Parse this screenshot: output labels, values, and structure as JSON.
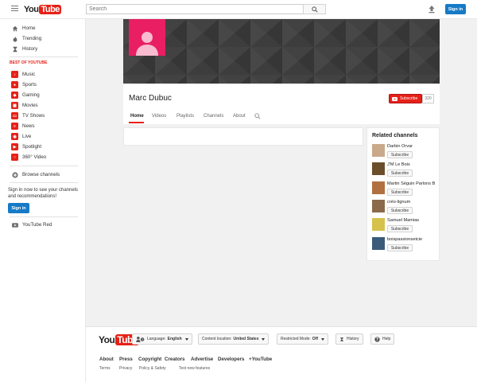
{
  "masthead": {
    "logo_you": "You",
    "logo_tube": "Tube",
    "search_placeholder": "Search",
    "signin_label": "Sign in"
  },
  "guide": {
    "primary": [
      {
        "label": "Home",
        "icon": "home-icon"
      },
      {
        "label": "Trending",
        "icon": "flame-icon"
      },
      {
        "label": "History",
        "icon": "hourglass-icon"
      }
    ],
    "best_of_heading": "BEST OF YOUTUBE",
    "best_of": [
      {
        "label": "Music",
        "icon": "music-icon"
      },
      {
        "label": "Sports",
        "icon": "sports-icon"
      },
      {
        "label": "Gaming",
        "icon": "gaming-icon"
      },
      {
        "label": "Movies",
        "icon": "movies-icon"
      },
      {
        "label": "TV Shows",
        "icon": "tv-icon"
      },
      {
        "label": "News",
        "icon": "news-icon"
      },
      {
        "label": "Live",
        "icon": "live-icon"
      },
      {
        "label": "Spotlight",
        "icon": "spotlight-icon"
      },
      {
        "label": "360° Video",
        "icon": "360-icon"
      }
    ],
    "browse_channels": "Browse channels",
    "signin_promo": "Sign in now to see your channels and recommendations!",
    "signin_label": "Sign in",
    "youtube_red": "YouTube Red"
  },
  "channel": {
    "title": "Marc Dubuc",
    "subscribe_label": "Subscribe",
    "subscriber_count": "320",
    "tabs": [
      "Home",
      "Videos",
      "Playlists",
      "Channels",
      "About"
    ],
    "active_tab": "Home"
  },
  "related": {
    "title": "Related channels",
    "subscribe_label": "Subscribe",
    "channels": [
      {
        "name": "Darbin Orvar",
        "thumb_color": "#c9a98a"
      },
      {
        "name": "J'M Le Bois",
        "thumb_color": "#6b4f2a"
      },
      {
        "name": "Martin Séguin Parlons Bois",
        "thumb_color": "#b07040"
      },
      {
        "name": "créo-lignum",
        "thumb_color": "#8a6a4a"
      },
      {
        "name": "Samuel Mamias",
        "thumb_color": "#d6c24a"
      },
      {
        "name": "boispassionsetcie",
        "thumb_color": "#3a5a7a"
      }
    ]
  },
  "footer": {
    "language_label": "Language:",
    "language_value": "English",
    "location_label": "Content location:",
    "location_value": "United States",
    "restricted_label": "Restricted Mode:",
    "restricted_value": "Off",
    "history_label": "History",
    "help_label": "Help",
    "links": [
      "About",
      "Press",
      "Copyright",
      "Creators",
      "Advertise",
      "Developers",
      "+YouTube"
    ],
    "small_links": [
      "Terms",
      "Privacy",
      "Policy & Safety",
      "Test new features"
    ]
  },
  "colors": {
    "brand_red": "#e62117",
    "signin_blue": "#167ac6",
    "avatar_pink": "#e91e63"
  }
}
